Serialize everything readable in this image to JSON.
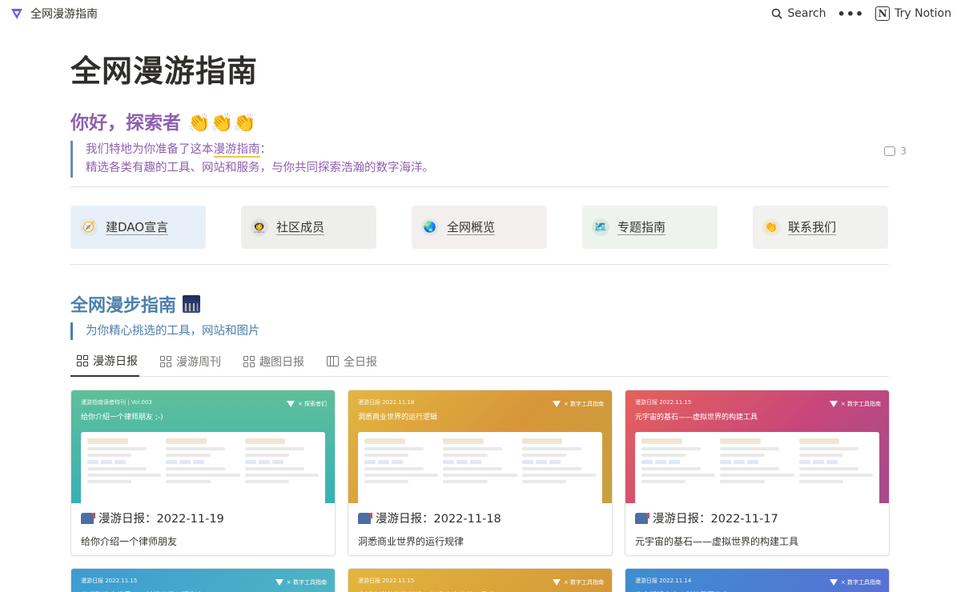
{
  "topbar": {
    "site_title": "全网漫游指南",
    "search_label": "Search",
    "more_label": "•••",
    "try_label": "Try Notion"
  },
  "page": {
    "title": "全网漫游指南",
    "greeting": "你好，探索者 👏👏👏",
    "intro_line1_pre": "我们特地为你准备了这本",
    "intro_line1_highlight": "漫游指南",
    "intro_line1_post": "：",
    "intro_line2": "精选各类有趣的工具、网站和服务，与你共同探索浩瀚的数字海洋。",
    "comment_count": "3"
  },
  "nav": [
    {
      "label": "建DAO宣言",
      "icon": "compass-icon",
      "glyph": "🧭",
      "bg": "#e7f0f8"
    },
    {
      "label": "社区成员",
      "icon": "astronaut-icon",
      "glyph": "👩‍🚀",
      "bg": "#eeeeec"
    },
    {
      "label": "全网概览",
      "icon": "globe-icon",
      "glyph": "🌏",
      "bg": "#f3efee"
    },
    {
      "label": "专题指南",
      "icon": "map-icon",
      "glyph": "🗺️",
      "bg": "#eef3ed"
    },
    {
      "label": "联系我们",
      "icon": "clap-icon",
      "glyph": "👏",
      "bg": "#f1f1ef"
    }
  ],
  "section": {
    "title": "全网漫步指南",
    "subtitle": "为你精心挑选的工具，网站和图片"
  },
  "tabs": [
    {
      "label": "漫游日报",
      "icon": "gallery-icon",
      "active": true
    },
    {
      "label": "漫游周刊",
      "icon": "gallery-icon",
      "active": false
    },
    {
      "label": "趣图日报",
      "icon": "gallery-icon",
      "active": false
    },
    {
      "label": "全日报",
      "icon": "table-icon",
      "active": false
    }
  ],
  "cards": [
    {
      "title": "漫游日报：2022-11-19",
      "subtitle": "给你介绍一个律师朋友",
      "cover_top": "漫游指南读者特刊 | Vol.003",
      "cover_title": "给你介绍一个律师朋友 ;-)",
      "cover_brand": "× 探索者们",
      "gradient": "linear-gradient(180deg,#5fbf9a 0%,#36b2b6 100%)"
    },
    {
      "title": "漫游日报：2022-11-18",
      "subtitle": "洞悉商业世界的运行规律",
      "cover_top": "漫游日报 2022.11.18",
      "cover_title": "洞悉商业世界的运行逻辑",
      "cover_brand": "× 数字工具指南",
      "gradient": "linear-gradient(135deg,#e2b640 0%,#d7953a 55%,#c7a13c 100%)"
    },
    {
      "title": "漫游日报：2022-11-17",
      "subtitle": "元宇宙的基石——虚拟世界的构建工具",
      "cover_top": "漫游日报 2022.11.15",
      "cover_title": "元宇宙的基石——虚拟世界的构建工具",
      "cover_brand": "× 数字工具指南",
      "gradient": "linear-gradient(135deg,#e5615c 0%,#c8477a 55%,#a34b8e 100%)"
    },
    {
      "cover_top": "漫游日报 2022.11.15",
      "cover_title": "用代码改变世界——前端开发入门指南",
      "cover_brand": "× 数字工具指南",
      "gradient": "linear-gradient(135deg,#3d9bd3 0%,#4fb6c2 100%)"
    },
    {
      "cover_top": "漫游日报 2022.11.15",
      "cover_title": "全域自媒体创作精选，打造个人运营工具库",
      "cover_brand": "× 数字工具指南",
      "gradient": "linear-gradient(135deg,#e4b53d 0%,#d39739 100%)"
    },
    {
      "cover_top": "漫游日报 2022.11.14",
      "cover_title": "信息期望自由，科技需要分享",
      "cover_brand": "× 数字工具指南",
      "gradient": "linear-gradient(135deg,#3c8fd0 0%,#5a6fd4 100%)"
    }
  ]
}
